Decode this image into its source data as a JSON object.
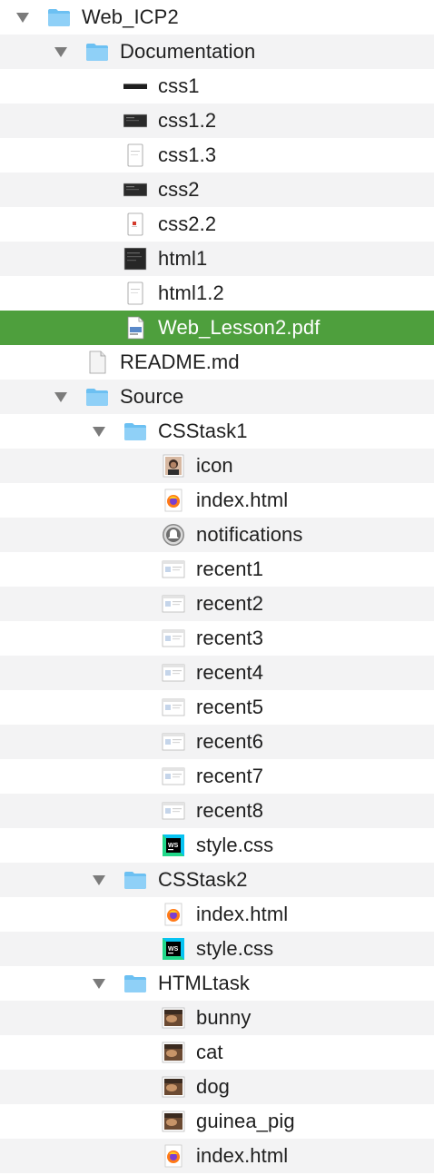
{
  "rows": [
    {
      "name": "Web_ICP2",
      "type": "folder",
      "expanded": true,
      "depth": 0,
      "icon": "folder-icon"
    },
    {
      "name": "Documentation",
      "type": "folder",
      "expanded": true,
      "depth": 1,
      "icon": "folder-icon"
    },
    {
      "name": "css1",
      "type": "file",
      "depth": 2,
      "icon": "screenshot-wide-dark-icon"
    },
    {
      "name": "css1.2",
      "type": "file",
      "depth": 2,
      "icon": "screenshot-dark-icon"
    },
    {
      "name": "css1.3",
      "type": "file",
      "depth": 2,
      "icon": "screenshot-portrait-icon"
    },
    {
      "name": "css2",
      "type": "file",
      "depth": 2,
      "icon": "screenshot-dark-icon"
    },
    {
      "name": "css2.2",
      "type": "file",
      "depth": 2,
      "icon": "screenshot-portrait-red-icon"
    },
    {
      "name": "html1",
      "type": "file",
      "depth": 2,
      "icon": "screenshot-dark-square-icon"
    },
    {
      "name": "html1.2",
      "type": "file",
      "depth": 2,
      "icon": "screenshot-portrait-icon"
    },
    {
      "name": "Web_Lesson2.pdf",
      "type": "file",
      "depth": 2,
      "icon": "pdf-icon",
      "selected": true
    },
    {
      "name": "README.md",
      "type": "file",
      "depth": 1,
      "icon": "document-icon"
    },
    {
      "name": "Source",
      "type": "folder",
      "expanded": true,
      "depth": 1,
      "icon": "folder-icon"
    },
    {
      "name": "CSStask1",
      "type": "folder",
      "expanded": true,
      "depth": 2,
      "icon": "folder-icon"
    },
    {
      "name": "icon",
      "type": "file",
      "depth": 3,
      "icon": "photo-portrait-icon"
    },
    {
      "name": "index.html",
      "type": "file",
      "depth": 3,
      "icon": "firefox-icon"
    },
    {
      "name": "notifications",
      "type": "file",
      "depth": 3,
      "icon": "notification-bell-icon"
    },
    {
      "name": "recent1",
      "type": "file",
      "depth": 3,
      "icon": "window-screenshot-icon"
    },
    {
      "name": "recent2",
      "type": "file",
      "depth": 3,
      "icon": "window-screenshot-icon"
    },
    {
      "name": "recent3",
      "type": "file",
      "depth": 3,
      "icon": "window-screenshot-icon"
    },
    {
      "name": "recent4",
      "type": "file",
      "depth": 3,
      "icon": "window-screenshot-icon"
    },
    {
      "name": "recent5",
      "type": "file",
      "depth": 3,
      "icon": "window-screenshot-icon"
    },
    {
      "name": "recent6",
      "type": "file",
      "depth": 3,
      "icon": "window-screenshot-icon"
    },
    {
      "name": "recent7",
      "type": "file",
      "depth": 3,
      "icon": "window-screenshot-icon"
    },
    {
      "name": "recent8",
      "type": "file",
      "depth": 3,
      "icon": "window-screenshot-icon"
    },
    {
      "name": "style.css",
      "type": "file",
      "depth": 3,
      "icon": "webstorm-icon"
    },
    {
      "name": "CSStask2",
      "type": "folder",
      "expanded": true,
      "depth": 2,
      "icon": "folder-icon"
    },
    {
      "name": "index.html",
      "type": "file",
      "depth": 3,
      "icon": "firefox-icon"
    },
    {
      "name": "style.css",
      "type": "file",
      "depth": 3,
      "icon": "webstorm-icon"
    },
    {
      "name": "HTMLtask",
      "type": "folder",
      "expanded": true,
      "depth": 2,
      "icon": "folder-icon"
    },
    {
      "name": "bunny",
      "type": "file",
      "depth": 3,
      "icon": "photo-icon"
    },
    {
      "name": "cat",
      "type": "file",
      "depth": 3,
      "icon": "photo-icon"
    },
    {
      "name": "dog",
      "type": "file",
      "depth": 3,
      "icon": "photo-icon"
    },
    {
      "name": "guinea_pig",
      "type": "file",
      "depth": 3,
      "icon": "photo-icon"
    },
    {
      "name": "index.html",
      "type": "file",
      "depth": 3,
      "icon": "firefox-icon"
    }
  ],
  "colors": {
    "selection": "#4e9f3d",
    "folder": "#6cc0f2",
    "stripe": "#f3f3f4",
    "disclosure": "#7b7b7b"
  }
}
